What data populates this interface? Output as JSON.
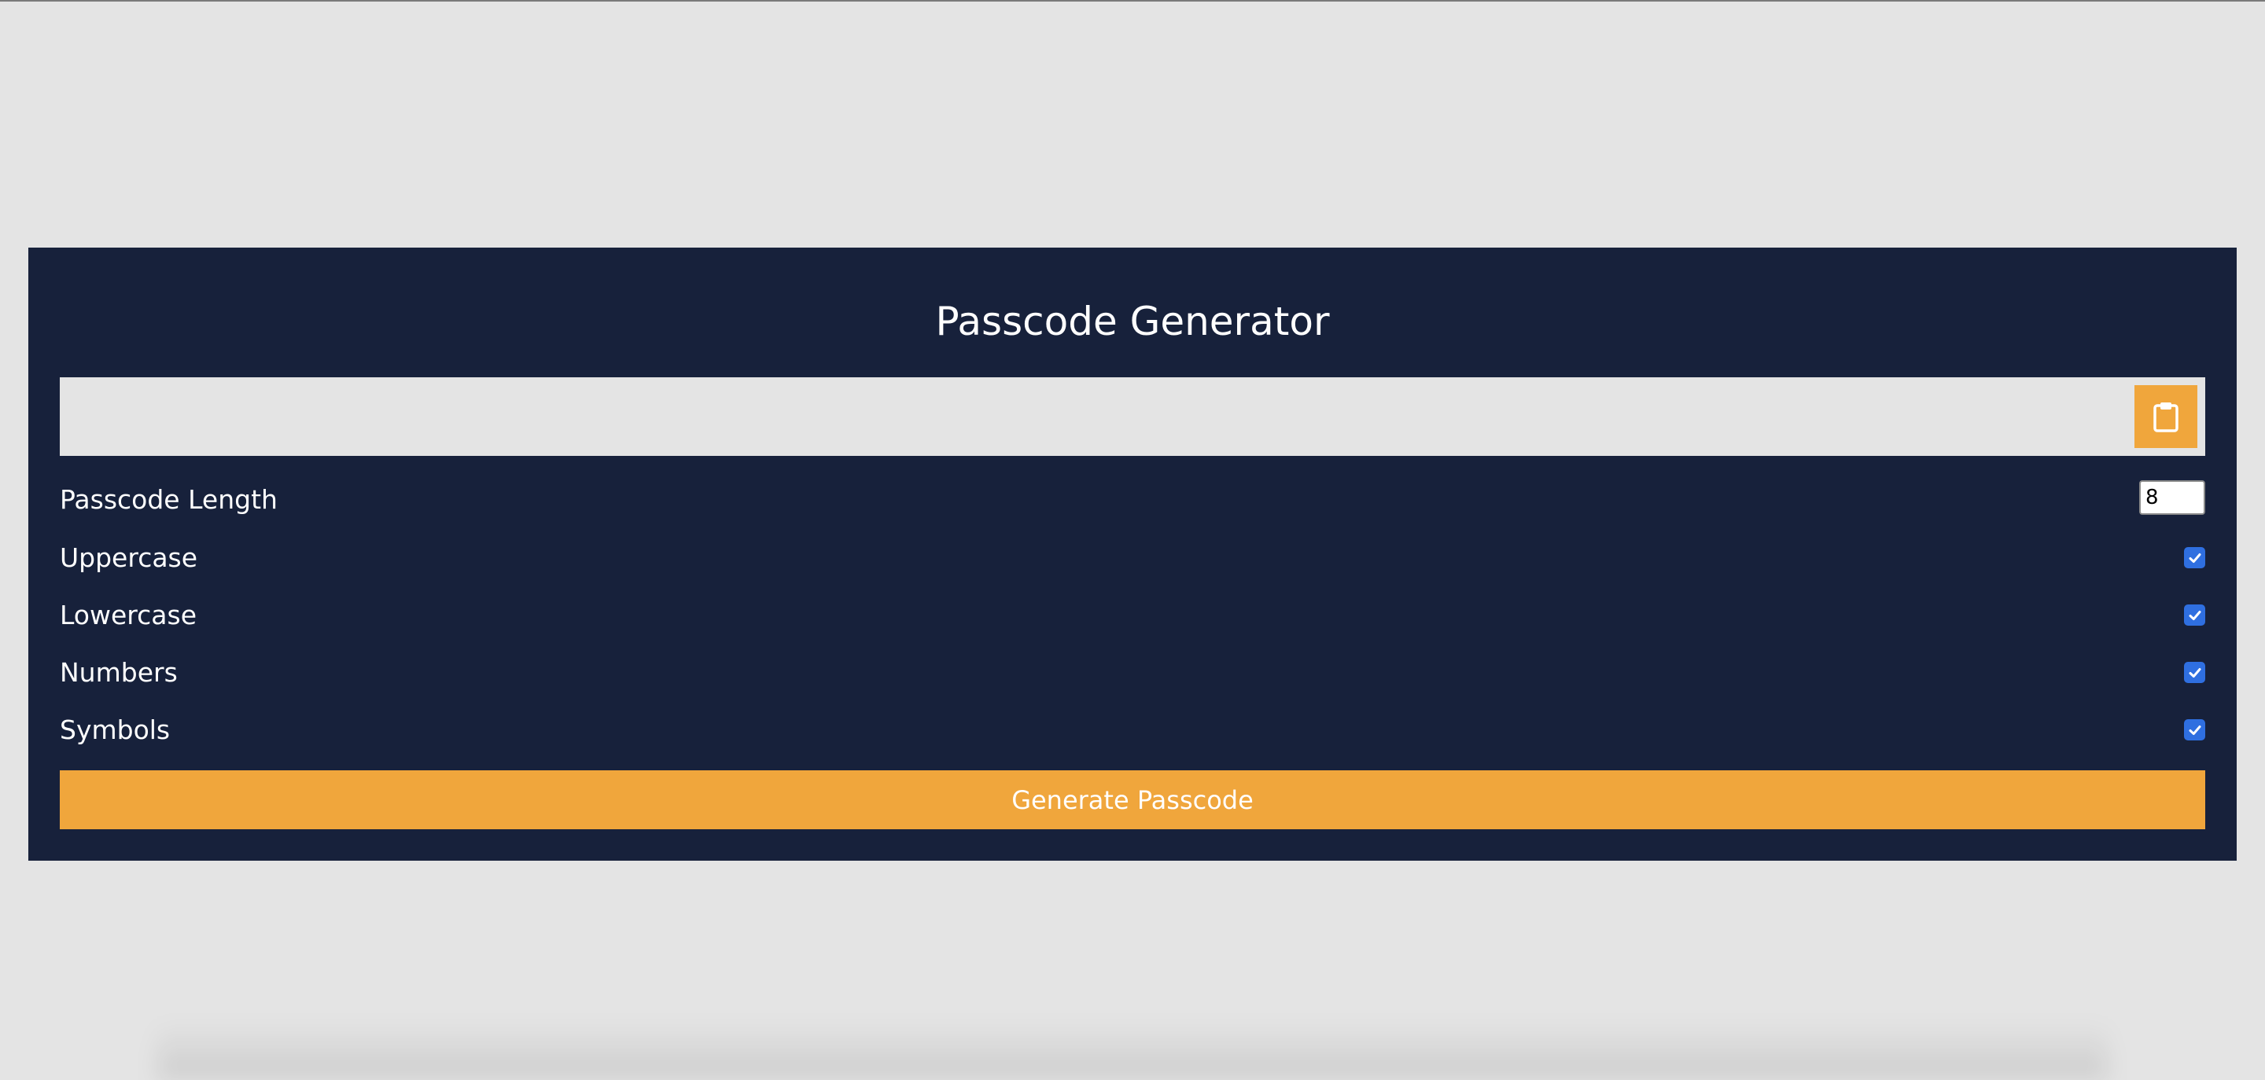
{
  "app": {
    "title": "Passcode Generator"
  },
  "result": {
    "value": "",
    "copy_icon": "clipboard-icon"
  },
  "settings": {
    "length_label": "Passcode Length",
    "length_value": "8",
    "options": [
      {
        "label": "Uppercase",
        "checked": true
      },
      {
        "label": "Lowercase",
        "checked": true
      },
      {
        "label": "Numbers",
        "checked": true
      },
      {
        "label": "Symbols",
        "checked": true
      }
    ]
  },
  "generate_label": "Generate Passcode",
  "colors": {
    "background": "#e4e4e4",
    "panel": "#17213b",
    "accent": "#f0a63c",
    "checkbox": "#2f6fe0"
  }
}
